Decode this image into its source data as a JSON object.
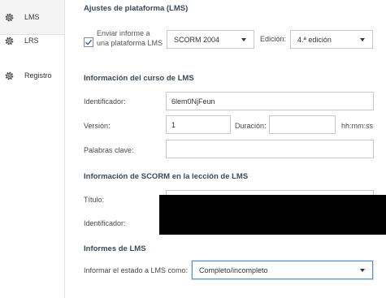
{
  "sidebar": {
    "items": [
      {
        "label": "LMS",
        "icon": "gear-icon"
      },
      {
        "label": "LRS",
        "icon": "gear-icon"
      },
      {
        "label": "Registro",
        "icon": "gear-icon"
      }
    ]
  },
  "platform": {
    "title": "Ajustes de plataforma (LMS)",
    "report_checkbox_label": "Enviar informe a una plataforma LMS",
    "report_checked": true,
    "standard_value": "SCORM 2004",
    "edition_label": "Edición:",
    "edition_value": "4.ª edición"
  },
  "course": {
    "title": "Información del curso de LMS",
    "identifier_label": "Identificador:",
    "identifier_value": "6lem0NjFeun",
    "version_label": "Versión:",
    "version_value": "1",
    "duration_label": "Duración:",
    "duration_value": "",
    "duration_unit": "hh:mm:ss",
    "keywords_label": "Palabras clave:",
    "keywords_value": ""
  },
  "lesson": {
    "title": "Información de SCORM en la lección de LMS",
    "title_label": "Título:",
    "identifier_label": "Identificador:"
  },
  "reports": {
    "title": "Informes de LMS",
    "report_status_label": "Informar el estado a LMS como:",
    "report_status_value": "Completo/incompleto"
  }
}
